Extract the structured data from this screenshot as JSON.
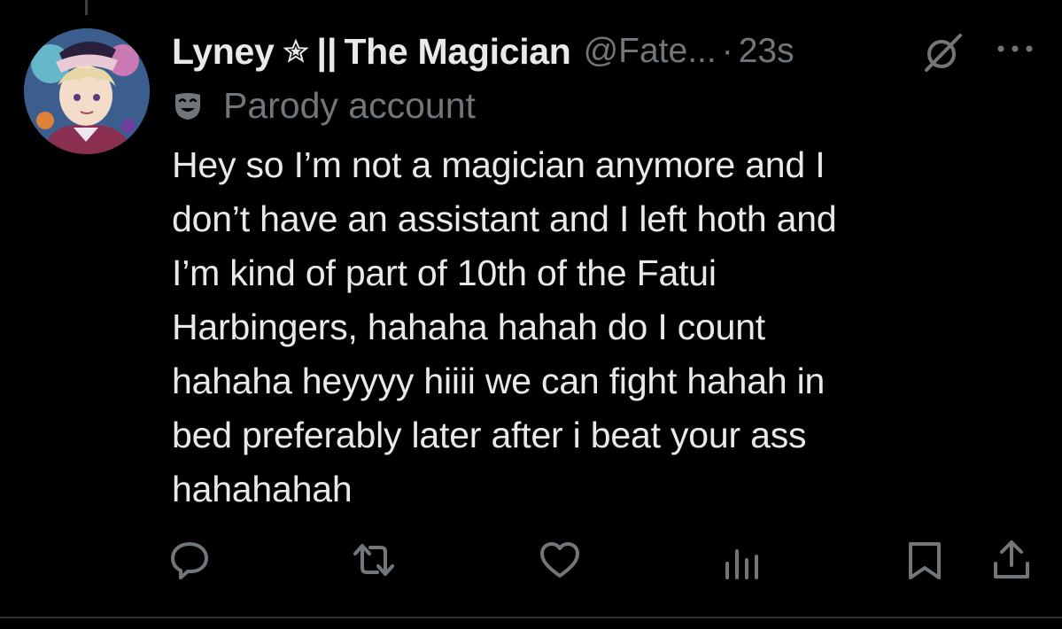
{
  "tweet": {
    "display_name": "Lyney",
    "name_separator": "||",
    "name_suffix": "The Magician",
    "handle": "@Fate...",
    "dot": "·",
    "time": "23s",
    "account_label": "Parody account",
    "text_lines": [
      "Hey so I’m not a magician anymore and I",
      "don’t have an assistant and I left hoth and",
      "I’m kind of part of 10th of the Fatui",
      "Harbingers, hahaha hahah do I count",
      "hahaha heyyyy hiiii we can fight hahah in",
      "bed preferably later after i beat your ass",
      "hahahahah"
    ]
  },
  "icons": {
    "star": "star-outline-icon",
    "mute": "mute-icon",
    "more": "more-icon",
    "mask": "parody-mask-icon",
    "reply": "reply-icon",
    "retweet": "retweet-icon",
    "like": "like-icon",
    "views": "views-icon",
    "bookmark": "bookmark-icon",
    "share": "share-icon"
  },
  "colors": {
    "background": "#000000",
    "primary_text": "#e7e9ea",
    "secondary_text": "#71767b"
  }
}
